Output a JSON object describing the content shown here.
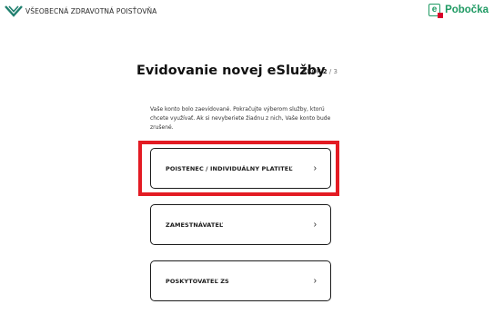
{
  "header": {
    "brand_name": "VŠEOBECNÁ ZDRAVOTNÁ POISŤOVŇA",
    "brand_color": "#1f7f6e",
    "epobocka_letter": "e",
    "epobocka_label": "Pobočka",
    "epobocka_color": "#1f9a63"
  },
  "main": {
    "title": "Evidovanie novej eSlužby",
    "step_label": "KROK",
    "step_current": "2",
    "step_separator": "/",
    "step_total": "3",
    "description": "Vaše konto bolo zaevidované. Pokračujte výberom služby, ktorú chcete využívať. Ak si nevyberiete žiadnu z nich, Vaše konto bude zrušené.",
    "options": [
      {
        "label": "POISTENEC / INDIVIDUÁLNY PLATITEĽ",
        "chevron": "›"
      },
      {
        "label": "ZAMESTNÁVATEĽ",
        "chevron": "›"
      },
      {
        "label": "POSKYTOVATEĽ ZS",
        "chevron": "›"
      }
    ]
  },
  "highlight_color": "#e31b23"
}
